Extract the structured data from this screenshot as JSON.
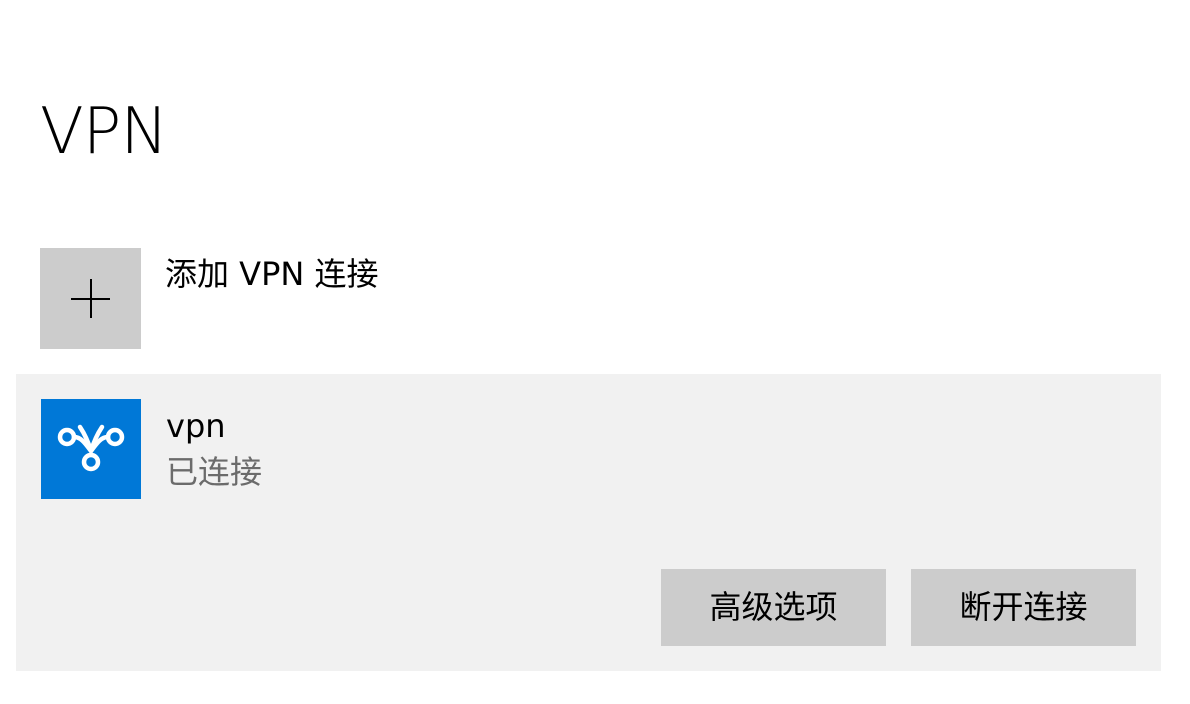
{
  "page": {
    "title": "VPN"
  },
  "add_connection": {
    "label": "添加 VPN 连接",
    "icon": "plus-icon"
  },
  "connection": {
    "name": "vpn",
    "status": "已连接",
    "icon": "vpn-icon",
    "icon_color": "#0078d7",
    "buttons": {
      "advanced": "高级选项",
      "disconnect": "断开连接"
    }
  }
}
